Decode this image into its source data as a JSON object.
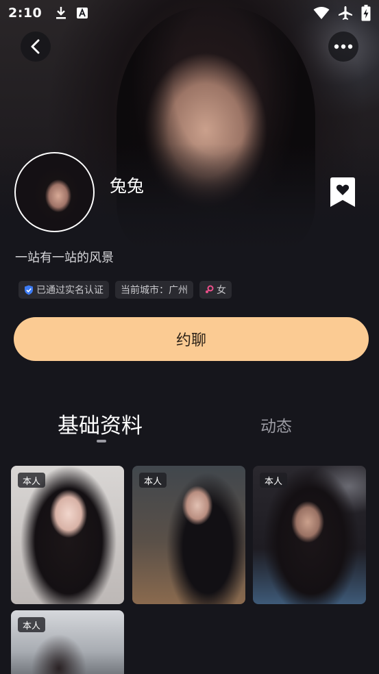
{
  "status_bar": {
    "time": "2:10",
    "left_icons": [
      "download-icon",
      "text-a-icon"
    ],
    "right_icons": [
      "wifi-icon",
      "airplane-icon",
      "battery-charging-icon"
    ]
  },
  "header": {
    "back_icon": "chevron-left-icon",
    "more_icon": "more-dots-icon"
  },
  "profile": {
    "nickname": "兔兔",
    "bio": "一站有一站的风景",
    "bookmark_icon": "heart-bookmark-icon",
    "tags": [
      {
        "icon": "verified-shield-icon",
        "label": "已通过实名认证"
      },
      {
        "icon": "",
        "label": "当前城市：广州"
      },
      {
        "icon": "female-icon",
        "label": "女"
      }
    ]
  },
  "actions": {
    "chat_label": "约聊"
  },
  "tabs": [
    {
      "label": "基础资料",
      "active": true
    },
    {
      "label": "动态",
      "active": false
    }
  ],
  "photos": [
    {
      "badge": "本人"
    },
    {
      "badge": "本人"
    },
    {
      "badge": "本人"
    },
    {
      "badge": "本人"
    }
  ],
  "colors": {
    "background": "#16161c",
    "chat_button": "#fbcb93",
    "tag_background": "#2a2a30",
    "verified_blue": "#3d7cf5",
    "female_pink": "#f0508c"
  }
}
